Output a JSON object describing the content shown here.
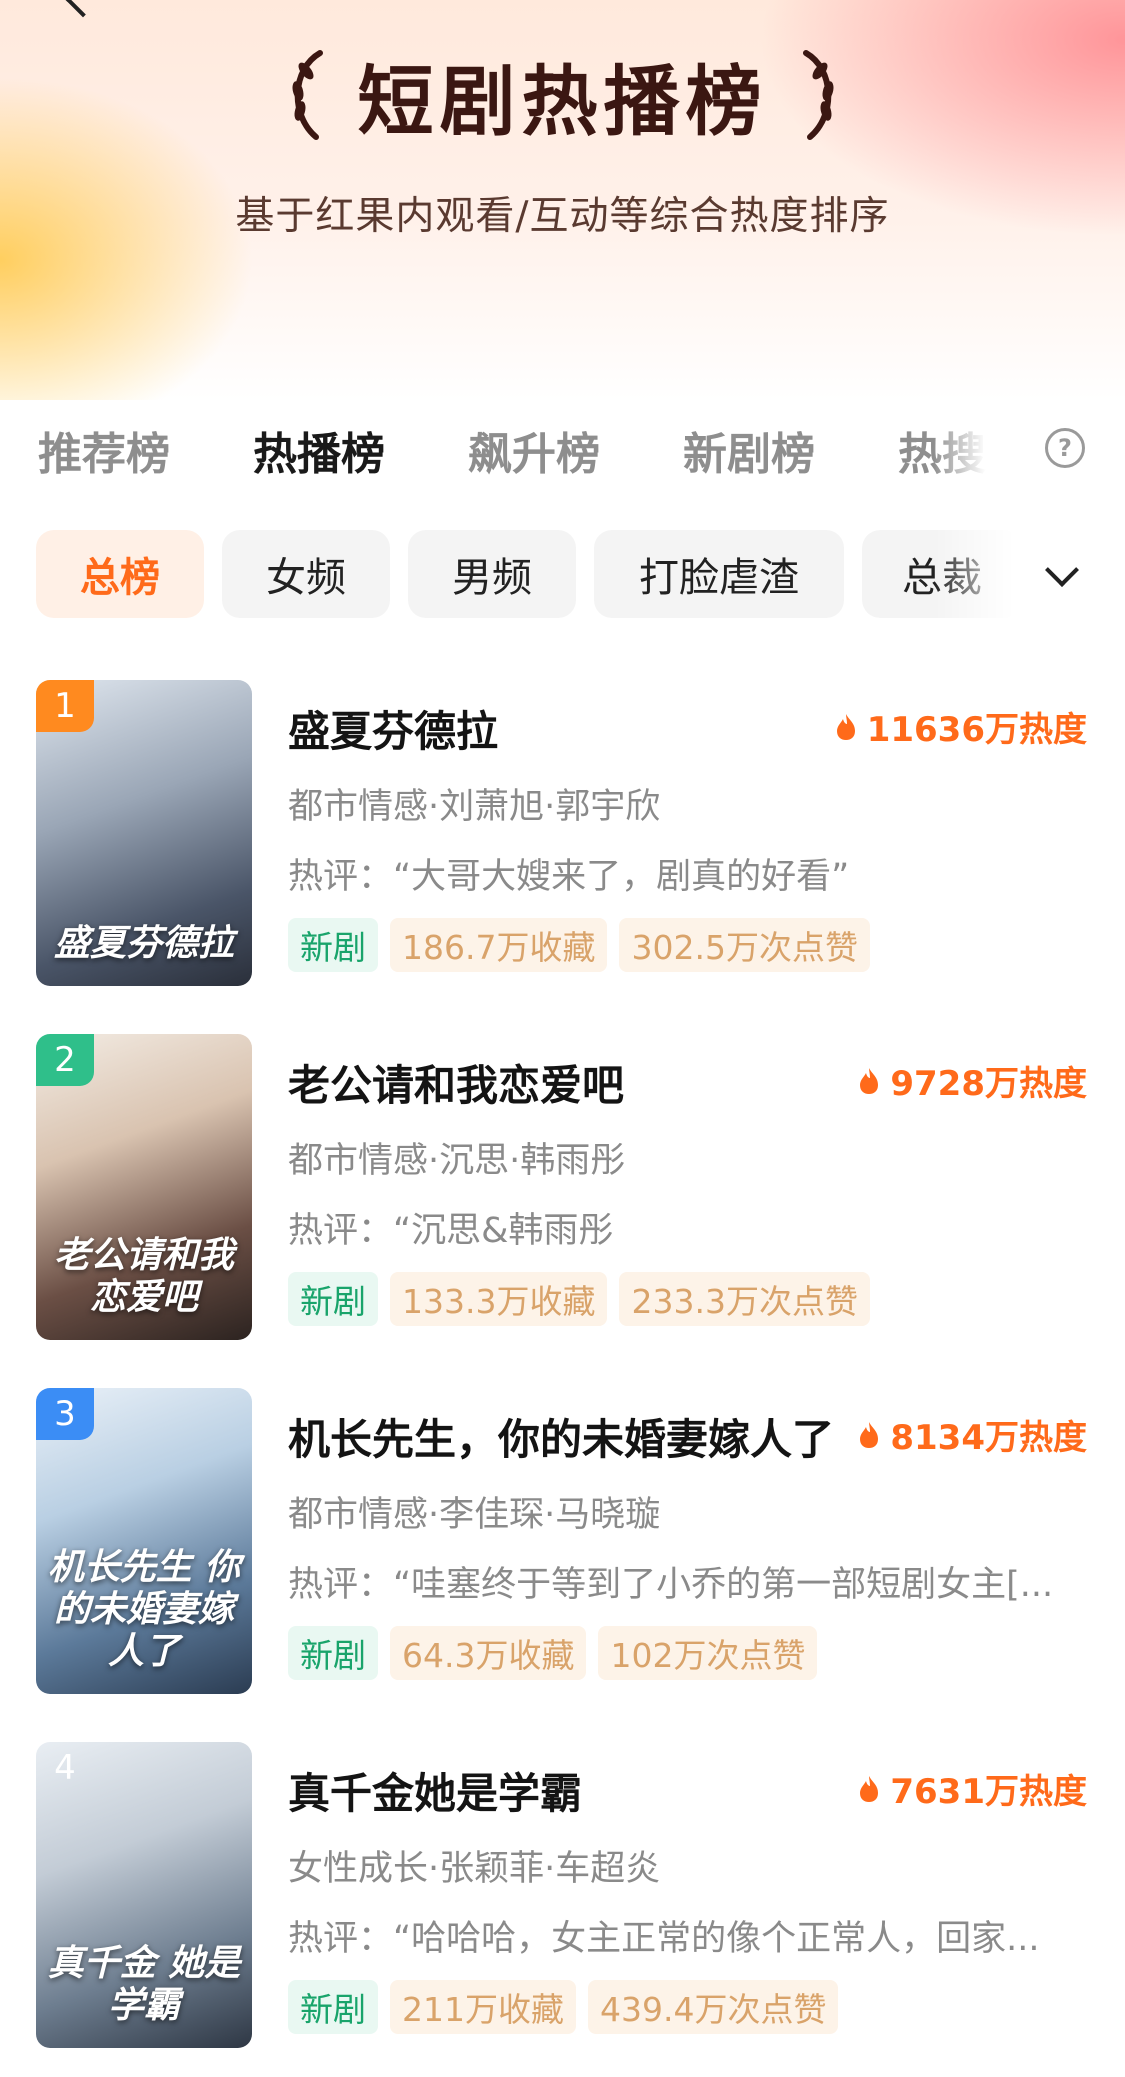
{
  "header": {
    "title": "短剧热播榜",
    "subtitle": "基于红果内观看/互动等综合热度排序"
  },
  "tabs": [
    {
      "label": "推荐榜"
    },
    {
      "label": "热播榜"
    },
    {
      "label": "飙升榜"
    },
    {
      "label": "新剧榜"
    },
    {
      "label": "热搜"
    }
  ],
  "chips": [
    {
      "label": "总榜"
    },
    {
      "label": "女频"
    },
    {
      "label": "男频"
    },
    {
      "label": "打脸虐渣"
    },
    {
      "label": "总裁"
    }
  ],
  "help_glyph": "?",
  "items": [
    {
      "rank": "1",
      "title": "盛夏芬德拉",
      "heat": "11636万热度",
      "meta": "都市情感·刘萧旭·郭宇欣",
      "review": "热评：“大哥大嫂来了，剧真的好看”",
      "tag_new": "新剧",
      "favorites": "186.7万收藏",
      "likes": "302.5万次点赞",
      "poster_text": "盛夏芬德拉",
      "rank_color": "#ff8a1f"
    },
    {
      "rank": "2",
      "title": "老公请和我恋爱吧",
      "heat": "9728万热度",
      "meta": "都市情感·沉思·韩雨彤",
      "review": "热评：“沉思&韩雨彤",
      "tag_new": "新剧",
      "favorites": "133.3万收藏",
      "likes": "233.3万次点赞",
      "poster_text": "老公请和我恋爱吧",
      "rank_color": "#2fbf8a"
    },
    {
      "rank": "3",
      "title": "机长先生，你的未婚妻嫁人了",
      "heat": "8134万热度",
      "meta": "都市情感·李佳琛·马晓璇",
      "review": "热评：“哇塞终于等到了小乔的第一部短剧女主[...",
      "tag_new": "新剧",
      "favorites": "64.3万收藏",
      "likes": "102万次点赞",
      "poster_text": "机长先生 你的未婚妻嫁人了",
      "rank_color": "#3b8df5"
    },
    {
      "rank": "4",
      "title": "真千金她是学霸",
      "heat": "7631万热度",
      "meta": "女性成长·张颖菲·车超炎",
      "review": "热评：“哈哈哈，女主正常的像个正常人，回家...",
      "tag_new": "新剧",
      "favorites": "211万收藏",
      "likes": "439.4万次点赞",
      "poster_text": "真千金 她是学霸",
      "rank_color": "transparent"
    }
  ],
  "colors": {
    "accent": "#ff6a1a",
    "title_dark": "#3b1712",
    "new_tag_text": "#19a46b",
    "stat_tag_text": "#d9a36a"
  }
}
